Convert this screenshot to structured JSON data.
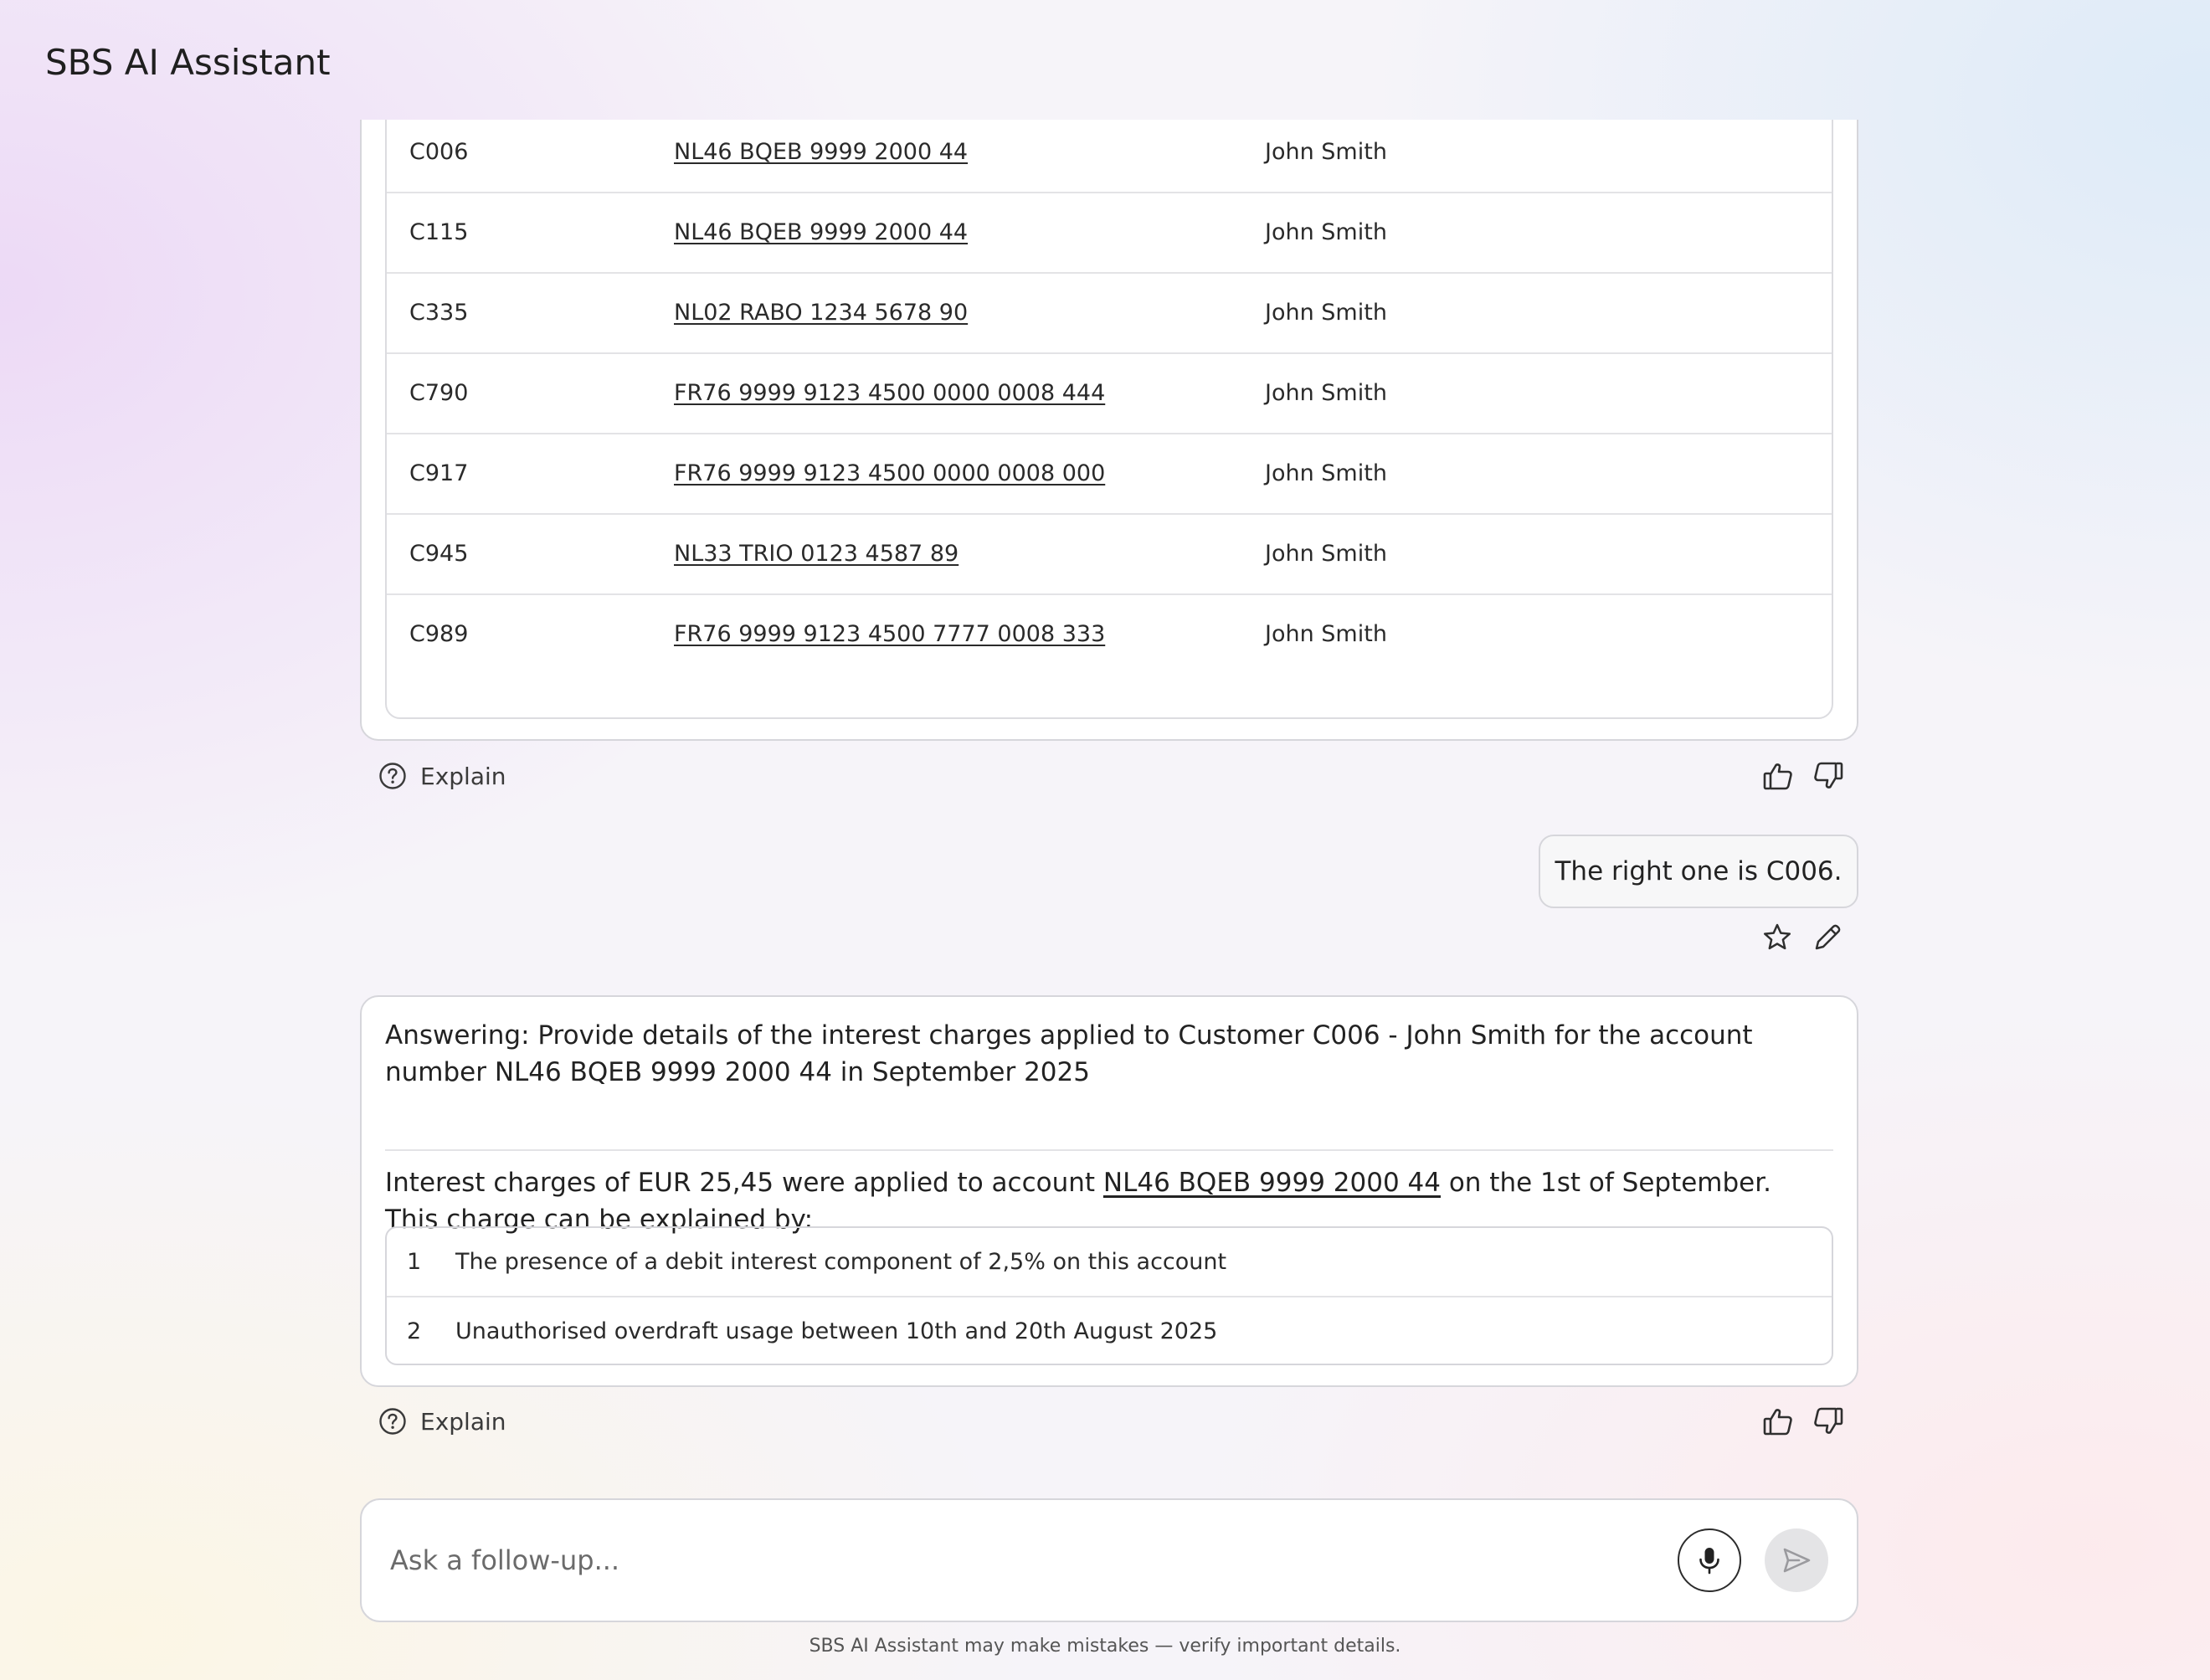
{
  "app": {
    "title": "SBS AI Assistant"
  },
  "customer_table": {
    "rows": [
      {
        "id": "C006",
        "iban": "NL46 BQEB 9999 2000 44",
        "name": "John Smith"
      },
      {
        "id": "C115",
        "iban": "NL46 BQEB 9999 2000 44",
        "name": "John Smith"
      },
      {
        "id": "C335",
        "iban": "NL02 RABO 1234 5678 90",
        "name": "John Smith"
      },
      {
        "id": "C790",
        "iban": "FR76 9999 9123 4500 0000 0008 444",
        "name": "John Smith"
      },
      {
        "id": "C917",
        "iban": "FR76 9999 9123 4500 0000 0008 000",
        "name": "John Smith"
      },
      {
        "id": "C945",
        "iban": "NL33 TRIO 0123 4587 89",
        "name": "John Smith"
      },
      {
        "id": "C989",
        "iban": "FR76 9999 9123 4500 7777 0008 333",
        "name": "John Smith"
      }
    ]
  },
  "actions": {
    "explain_label": "Explain",
    "thumbs_up_icon": "thumbs-up-icon",
    "thumbs_down_icon": "thumbs-down-icon",
    "star_icon": "star-icon",
    "edit_icon": "pencil-icon"
  },
  "user_message": {
    "text": "The right one is C006."
  },
  "answer": {
    "question": "Answering: Provide details of the interest charges applied to Customer C006 - John Smith for the account number NL46 BQEB 9999 2000 44 in September 2025",
    "body_prefix": "Interest charges of EUR 25,45 were applied to account",
    "body_link": "NL46 BQEB 9999 2000 44",
    "body_suffix": "on the 1st of September.",
    "body_line2": "This charge can be explained by:",
    "reasons": [
      {
        "num": "1",
        "text": "The presence of a debit interest component of 2,5% on this account"
      },
      {
        "num": "2",
        "text": "Unauthorised overdraft usage between 10th and 20th August 2025"
      }
    ]
  },
  "composer": {
    "placeholder": "Ask a follow-up...",
    "value": "",
    "mic_icon": "microphone-icon",
    "send_icon": "send-icon"
  },
  "footer": {
    "disclaimer": "SBS AI Assistant may make mistakes — verify important details."
  },
  "colors": {
    "card_border": "#d6d6db",
    "mic_border": "#2c2c2c",
    "send_bg": "#e4e4e6"
  }
}
